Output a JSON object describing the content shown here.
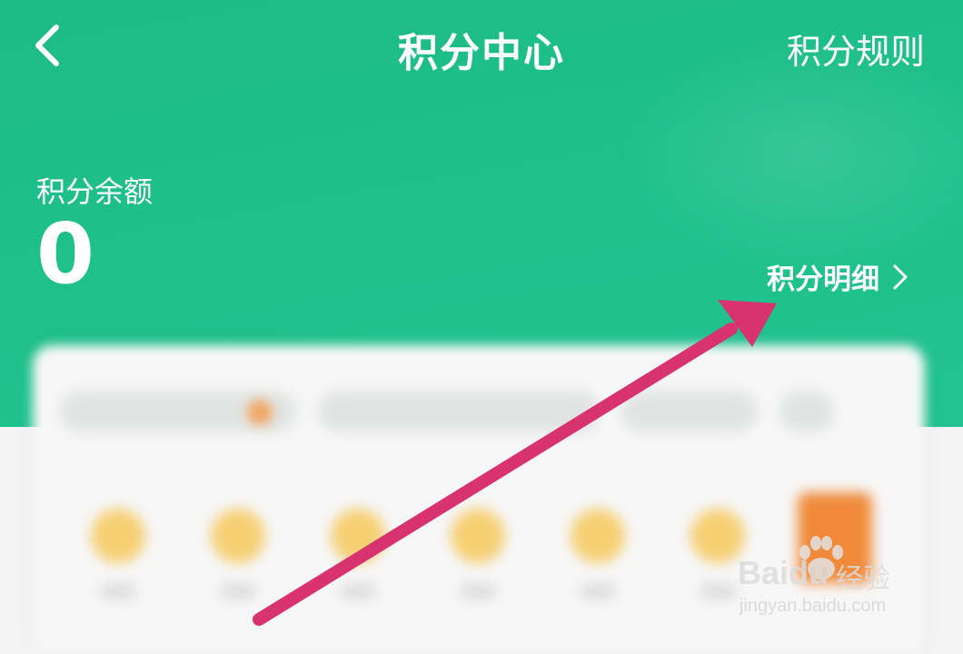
{
  "header": {
    "title": "积分中心",
    "rules_label": "积分规则",
    "back_icon": "chevron-left-icon"
  },
  "balance": {
    "label": "积分余额",
    "value": "0"
  },
  "detail_link": {
    "label": "积分明细",
    "icon": "chevron-right-icon"
  },
  "watermark": {
    "brand": "Baidu",
    "product": "经验",
    "url": "jingyan.baidu.com"
  },
  "colors": {
    "header_green": "#1fc18b",
    "arrow_pink": "#d8336f",
    "text_white": "#ffffff"
  }
}
